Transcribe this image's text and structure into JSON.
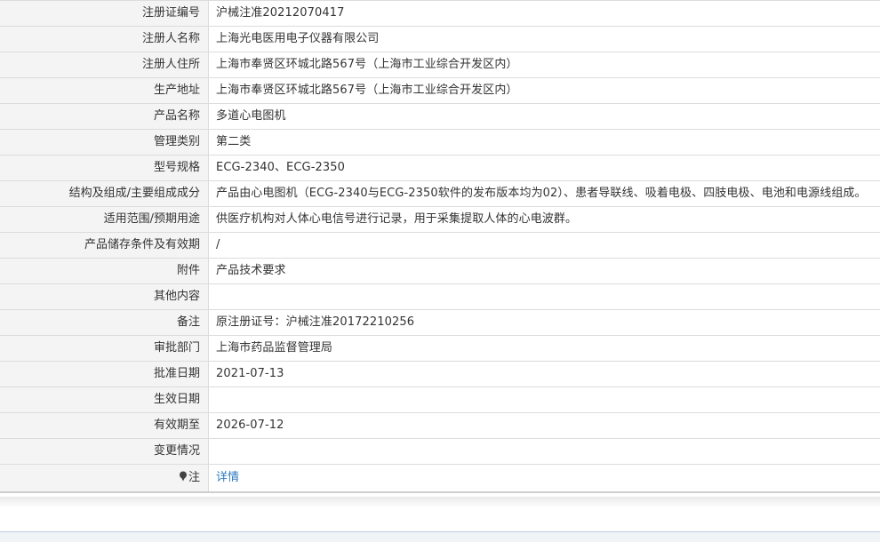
{
  "rows": [
    {
      "label": "注册证编号",
      "value": "沪械注准20212070417"
    },
    {
      "label": "注册人名称",
      "value": "上海光电医用电子仪器有限公司"
    },
    {
      "label": "注册人住所",
      "value": "上海市奉贤区环城北路567号（上海市工业综合开发区内）"
    },
    {
      "label": "生产地址",
      "value": "上海市奉贤区环城北路567号（上海市工业综合开发区内）"
    },
    {
      "label": "产品名称",
      "value": "多道心电图机"
    },
    {
      "label": "管理类别",
      "value": "第二类"
    },
    {
      "label": "型号规格",
      "value": "ECG-2340、ECG-2350"
    },
    {
      "label": "结构及组成/主要组成成分",
      "value": "产品由心电图机（ECG-2340与ECG-2350软件的发布版本均为02）、患者导联线、吸着电极、四肢电极、电池和电源线组成。"
    },
    {
      "label": "适用范围/预期用途",
      "value": "供医疗机构对人体心电信号进行记录，用于采集提取人体的心电波群。"
    },
    {
      "label": "产品储存条件及有效期",
      "value": "/"
    },
    {
      "label": "附件",
      "value": "产品技术要求"
    },
    {
      "label": "其他内容",
      "value": ""
    },
    {
      "label": "备注",
      "value": "原注册证号：沪械注准20172210256"
    },
    {
      "label": "审批部门",
      "value": "上海市药品监督管理局"
    },
    {
      "label": "批准日期",
      "value": "2021-07-13"
    },
    {
      "label": "生效日期",
      "value": ""
    },
    {
      "label": "有效期至",
      "value": "2026-07-12"
    },
    {
      "label": "变更情况",
      "value": ""
    }
  ],
  "note": {
    "icon": "pin-icon",
    "label": "注",
    "link_text": "详情",
    "link_color": "#2e7bbf"
  }
}
